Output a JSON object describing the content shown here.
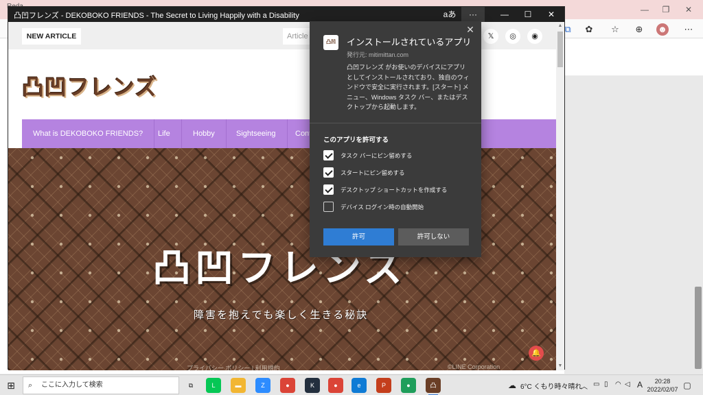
{
  "background_browser": {
    "title_partial": "Reda",
    "window_controls": [
      "—",
      "❐",
      "✕"
    ],
    "toolbar_icons": [
      "extensions-icon",
      "favorites-icon",
      "collections-icon",
      "profile-avatar",
      "more-icon"
    ]
  },
  "app_window": {
    "title": "凸凹フレンズ - DEKOBOKO FRIENDS - The Secret to Living Happily with a Disability",
    "title_extras": {
      "reader": "aあ",
      "more": "···",
      "minimize": "—",
      "maximize": "☐",
      "close": "✕"
    }
  },
  "site": {
    "new_article": "NEW ARTICLE",
    "search_placeholder": "Article",
    "social": [
      "𝕏",
      "◎",
      "◉"
    ],
    "logo": "凸凹フレンズ",
    "nav": [
      "What is DEKOBOKO FRIENDS?",
      "Life",
      "Hobby",
      "Sightseeing",
      "Cont"
    ],
    "hero_title": "凸凹フレンズ",
    "hero_subtitle": "障害を抱えでも楽しく生きる秘訣",
    "footer_left": "プライバシー ポリシー  |  利用規約",
    "footer_right": "©LINE Corporation"
  },
  "install_dialog": {
    "app_icon_text": "凸凹",
    "title": "インストールされているアプリ",
    "publisher": "発行元: mitimittan.com",
    "description": "凸凹フレンズ がお使いのデバイスにアプリとしてインストールされており、独自のウィンドウで安全に実行されます。[スタート] メニュー、Windows タスク バー、またはデスクトップから起動します。",
    "permissions_heading": "このアプリを許可する",
    "options": [
      {
        "label": "タスク バーにピン留めする",
        "checked": true
      },
      {
        "label": "スタートにピン留めする",
        "checked": true
      },
      {
        "label": "デスクトップ ショートカットを作成する",
        "checked": true
      },
      {
        "label": "デバイス ログイン時の自動開始",
        "checked": false
      }
    ],
    "allow_label": "許可",
    "deny_label": "許可しない",
    "close_glyph": "✕"
  },
  "taskbar": {
    "search_placeholder": "ここに入力して検索",
    "weather": "6°C くもり時々晴れ",
    "ime": "A",
    "time": "20:28",
    "date": "2022/02/07",
    "apps": [
      {
        "name": "task-view",
        "color": "#e6e6e6",
        "glyph": "⧉"
      },
      {
        "name": "line",
        "color": "#06c755",
        "glyph": "L"
      },
      {
        "name": "explorer",
        "color": "#f2b632",
        "glyph": "▬"
      },
      {
        "name": "zoom",
        "color": "#2d8cff",
        "glyph": "Z"
      },
      {
        "name": "chrome",
        "color": "#db4437",
        "glyph": "●"
      },
      {
        "name": "kindle",
        "color": "#232f3e",
        "glyph": "K"
      },
      {
        "name": "chrome2",
        "color": "#db4437",
        "glyph": "●"
      },
      {
        "name": "edge",
        "color": "#0f7bd5",
        "glyph": "e"
      },
      {
        "name": "powerpoint",
        "color": "#c43e1c",
        "glyph": "P"
      },
      {
        "name": "chrome-dev",
        "color": "#1f9e5b",
        "glyph": "●"
      },
      {
        "name": "dekoboko-app",
        "color": "#6a3e26",
        "glyph": "凸"
      }
    ]
  }
}
